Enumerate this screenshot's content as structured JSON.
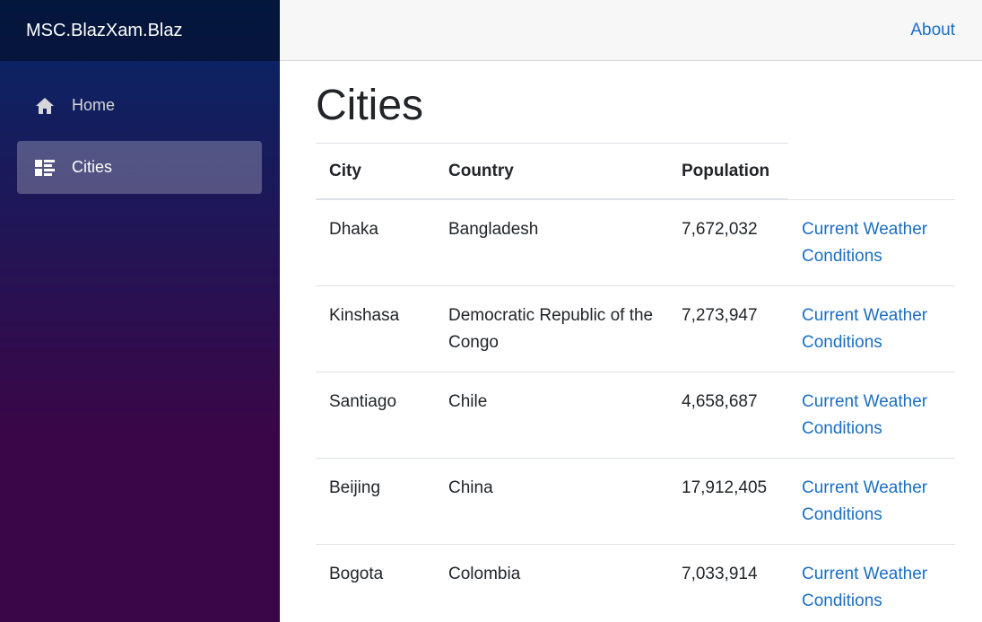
{
  "brand": {
    "title": "MSC.BlazXam.Blaz"
  },
  "nav": {
    "items": [
      {
        "label": "Home",
        "icon": "home-icon",
        "active": false
      },
      {
        "label": "Cities",
        "icon": "list-icon",
        "active": true
      }
    ]
  },
  "top_row": {
    "about_label": "About"
  },
  "page": {
    "title": "Cities"
  },
  "table": {
    "headers": {
      "city": "City",
      "country": "Country",
      "population": "Population"
    },
    "rows": [
      {
        "city": "Dhaka",
        "country": "Bangladesh",
        "population": "7,672,032",
        "link": "Current Weather Conditions"
      },
      {
        "city": "Kinshasa",
        "country": "Democratic Republic of the Congo",
        "population": "7,273,947",
        "link": "Current Weather Conditions"
      },
      {
        "city": "Santiago",
        "country": "Chile",
        "population": "4,658,687",
        "link": "Current Weather Conditions"
      },
      {
        "city": "Beijing",
        "country": "China",
        "population": "17,912,405",
        "link": "Current Weather Conditions"
      },
      {
        "city": "Bogota",
        "country": "Colombia",
        "population": "7,033,914",
        "link": "Current Weather Conditions"
      }
    ]
  },
  "colors": {
    "sidebar_top": "#052767",
    "sidebar_bottom": "#3a0647",
    "link": "#1b6ec2",
    "top_row_bg": "#f7f7f7"
  }
}
